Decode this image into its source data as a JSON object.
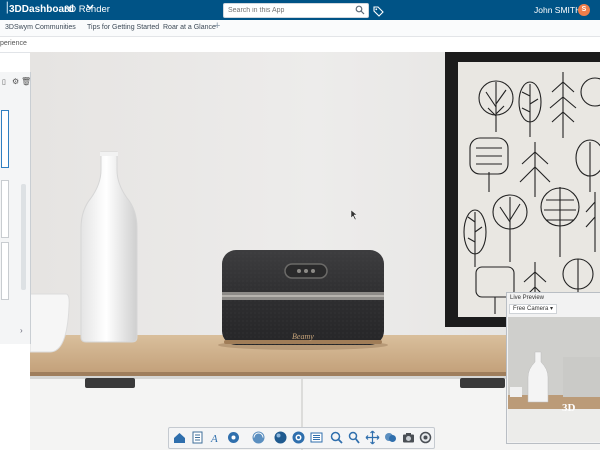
{
  "app": {
    "name": "3DDashboard",
    "subapp": "3D Render",
    "user": "John SMITH",
    "user_initial": "S",
    "brand_color": "#005386",
    "accent_color": "#ef7d4a"
  },
  "search": {
    "placeholder": "Search in this App"
  },
  "tabs": [
    {
      "label": "3DSwym Communities"
    },
    {
      "label": "Tips for Getting Started"
    },
    {
      "label": "Roar at a Glance"
    }
  ],
  "add_tab_label": "+",
  "widget": {
    "title": "perience"
  },
  "live_preview": {
    "title": "Live Preview",
    "camera": "Free Camera"
  },
  "scene": {
    "speaker_brand": "Beamy"
  },
  "toolbar_icons": [
    "home-icon",
    "document-icon",
    "text-style-icon",
    "settings-icon",
    "render-icon",
    "sphere-icon",
    "target-icon",
    "list-icon",
    "search-zoom-icon",
    "fit-icon",
    "move-icon",
    "layers-icon",
    "camera-icon",
    "magnify-icon"
  ]
}
